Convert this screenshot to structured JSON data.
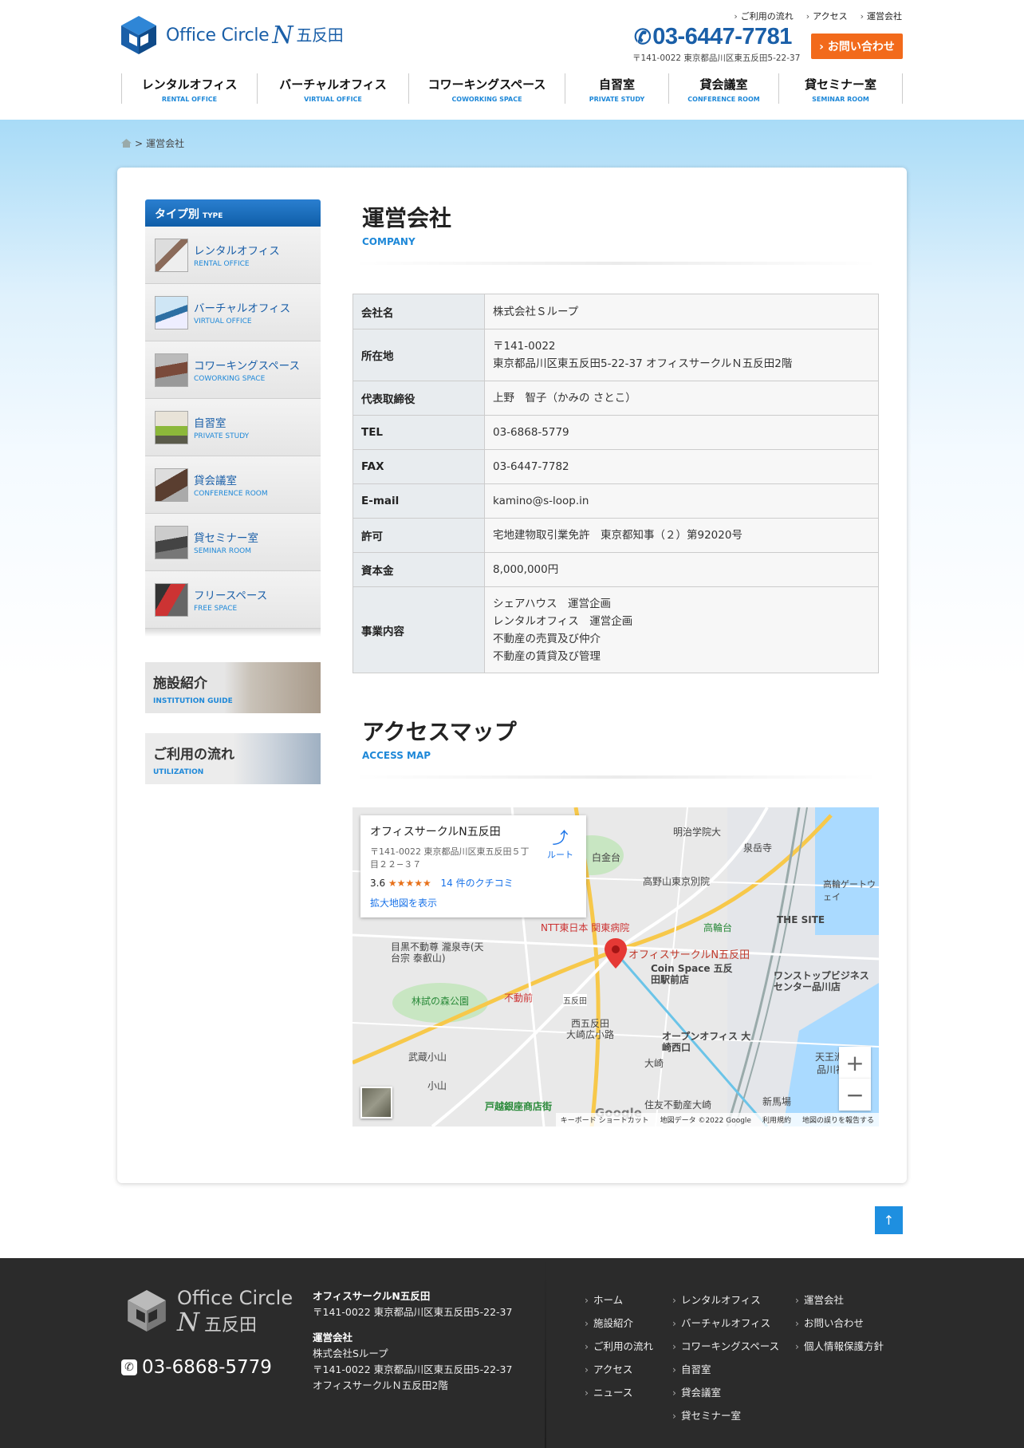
{
  "header": {
    "logo_text": "Office Circle",
    "logo_n": "N",
    "logo_kanji": "五反田",
    "top_links": [
      "ご利用の流れ",
      "アクセス",
      "運営会社"
    ],
    "phone": "03-6447-7781",
    "address": "〒141-0022 東京都品川区東五反田5-22-37",
    "contact_button": "› お問い合わせ",
    "nav": [
      {
        "jp": "レンタルオフィス",
        "en": "RENTAL OFFICE"
      },
      {
        "jp": "バーチャルオフィス",
        "en": "VIRTUAL OFFICE"
      },
      {
        "jp": "コワーキングスペース",
        "en": "COWORKING SPACE"
      },
      {
        "jp": "自習室",
        "en": "PRIVATE STUDY"
      },
      {
        "jp": "貸会議室",
        "en": "CONFERENCE ROOM"
      },
      {
        "jp": "貸セミナー室",
        "en": "SEMINAR ROOM"
      }
    ]
  },
  "breadcrumb": {
    "separator": ">",
    "current": "運営会社"
  },
  "sidebar": {
    "heading": "タイプ別",
    "heading_en": "TYPE",
    "items": [
      {
        "jp": "レンタルオフィス",
        "en": "RENTAL OFFICE"
      },
      {
        "jp": "バーチャルオフィス",
        "en": "VIRTUAL OFFICE"
      },
      {
        "jp": "コワーキングスペース",
        "en": "COWORKING SPACE"
      },
      {
        "jp": "自習室",
        "en": "PRIVATE STUDY"
      },
      {
        "jp": "貸会議室",
        "en": "CONFERENCE ROOM"
      },
      {
        "jp": "貸セミナー室",
        "en": "SEMINAR ROOM"
      },
      {
        "jp": "フリースペース",
        "en": "FREE SPACE"
      }
    ],
    "banners": [
      {
        "title": "施設紹介",
        "sub": "INSTITUTION GUIDE"
      },
      {
        "title": "ご利用の流れ",
        "sub": "UTILIZATION"
      }
    ]
  },
  "company": {
    "title": "運営会社",
    "subtitle": "COMPANY",
    "rows": [
      {
        "label": "会社名",
        "value": "株式会社Ｓループ"
      },
      {
        "label": "所在地",
        "value": "〒141-0022\n東京都品川区東五反田5-22-37 オフィスサークルＮ五反田2階"
      },
      {
        "label": "代表取締役",
        "value": "上野　智子（かみの さとこ）"
      },
      {
        "label": "TEL",
        "value": "03-6868-5779"
      },
      {
        "label": "FAX",
        "value": "03-6447-7782"
      },
      {
        "label": "E-mail",
        "value": "kamino@s-loop.in"
      },
      {
        "label": "許可",
        "value": "宅地建物取引業免許　東京都知事（２）第92020号"
      },
      {
        "label": "資本金",
        "value": "8,000,000円"
      },
      {
        "label": "事業内容",
        "value": "シェアハウス　運営企画\nレンタルオフィス　運営企画\n不動産の売買及び仲介\n不動産の賃貸及び管理"
      }
    ]
  },
  "access": {
    "title": "アクセスマップ",
    "subtitle": "ACCESS MAP",
    "map": {
      "place_name": "オフィスサークルN五反田",
      "place_address": "〒141-0022 東京都品川区東五反田５丁目２２−３７",
      "rating": "3.6",
      "stars": "★★★★★",
      "reviews": "14 件のクチコミ",
      "route": "ルート",
      "larger_map": "拡大地図を表示",
      "marker_label": "オフィスサークルN五反田",
      "labels": [
        "明治学院大",
        "泉岳寺",
        "白金台",
        "高野山東京別院",
        "高輪ゲートウェイ",
        "NTT東日本 関東病院",
        "高輪台",
        "THE SITE",
        "目黒不動尊 瀧泉寺(天台宗 泰叡山)",
        "Coin Space 五反田駅前店",
        "ワンストップビジネスセンター品川店",
        "林試の森公園",
        "不動前",
        "五反田",
        "西五反田",
        "大崎広小路",
        "オープンオフィス 大崎西口",
        "武蔵小山",
        "小山",
        "大崎",
        "天王洲",
        "品川神社",
        "新馬場",
        "戸越銀座商店街",
        "住友不動産大崎"
      ],
      "zoom_in": "+",
      "zoom_out": "−",
      "footer": [
        "キーボード ショートカット",
        "地図データ ©2022 Google",
        "利用規約",
        "地図の誤りを報告する"
      ],
      "google": "Google"
    }
  },
  "to_top": "↑",
  "footer": {
    "logo_text": "Office Circle",
    "logo_n": "N",
    "logo_kanji": "五反田",
    "phone": "03-6868-5779",
    "office_name": "オフィスサークルN五反田",
    "office_address": "〒141-0022 東京都品川区東五反田5-22-37",
    "company_heading": "運営会社",
    "company_name": "株式会社Sループ",
    "company_address": "〒141-0022 東京都品川区東五反田5-22-37",
    "company_building": "オフィスサークルＮ五反田2階",
    "links_col1": [
      "ホーム",
      "施設紹介",
      "ご利用の流れ",
      "アクセス",
      "ニュース"
    ],
    "links_col2": [
      "レンタルオフィス",
      "バーチャルオフィス",
      "コワーキングスペース",
      "自習室",
      "貸会議室",
      "貸セミナー室"
    ],
    "links_col3": [
      "運営会社",
      "お問い合わせ",
      "個人情報保護方針"
    ]
  },
  "colors": {
    "brand": "#1a5fa8",
    "accent": "#f26a1b",
    "link": "#1e88d8",
    "footer_bg": "#2b2b2b"
  }
}
